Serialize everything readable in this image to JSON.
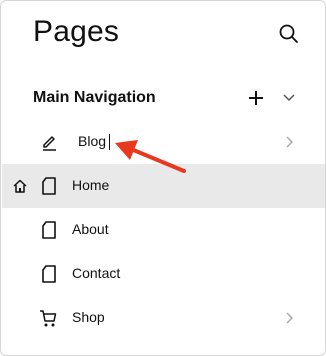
{
  "header": {
    "title": "Pages"
  },
  "section": {
    "title": "Main Navigation"
  },
  "items": [
    {
      "label": "Blog",
      "editing": true
    },
    {
      "label": "Home",
      "selected": true
    },
    {
      "label": "About"
    },
    {
      "label": "Contact"
    },
    {
      "label": "Shop"
    }
  ],
  "colors": {
    "accent_arrow": "#e8391f",
    "selected_row": "#e9e9e9"
  },
  "icons": {
    "search": "search-icon",
    "add": "plus-icon",
    "collapse": "chevron-down-icon",
    "blog": "pencil-icon",
    "page": "page-icon",
    "home": "home-icon",
    "shop": "cart-icon",
    "navigate": "chevron-right-icon"
  }
}
